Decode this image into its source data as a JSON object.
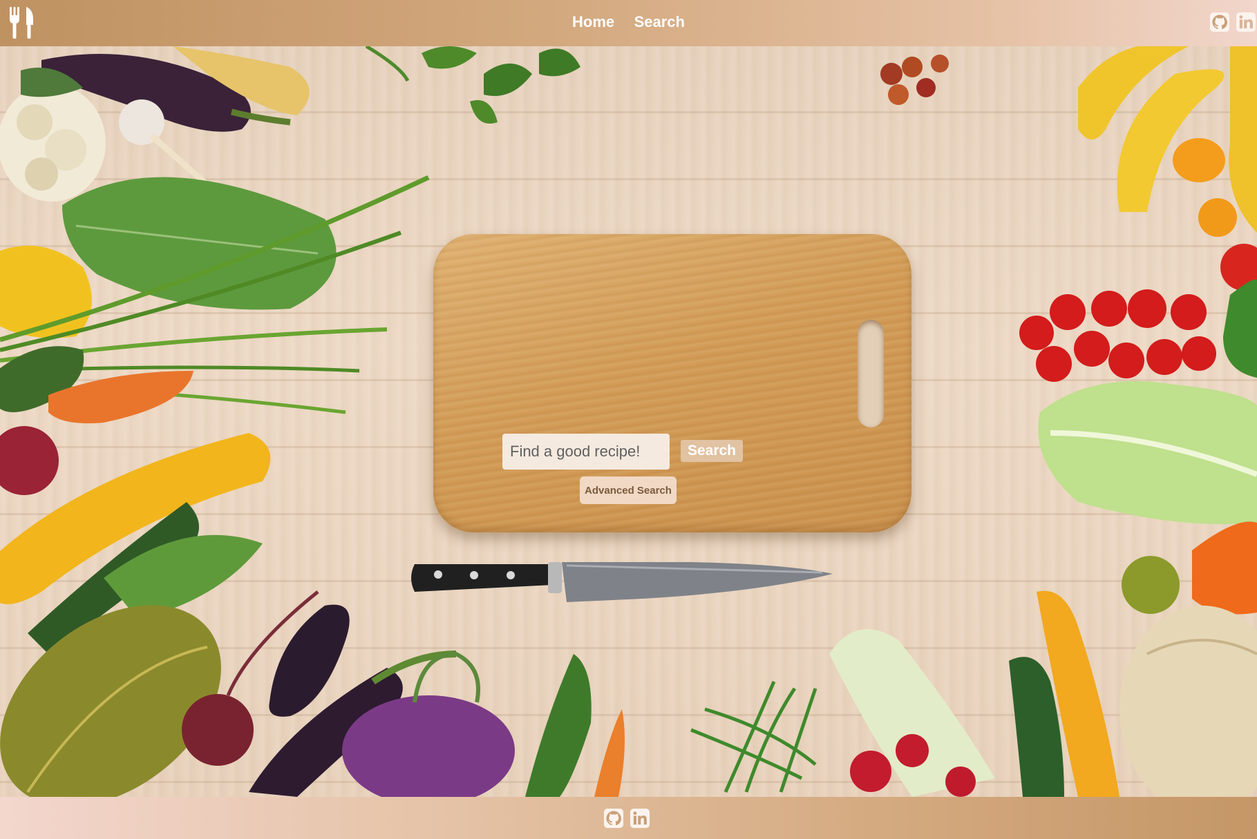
{
  "header": {
    "nav": [
      {
        "label": "Home"
      },
      {
        "label": "Search"
      }
    ],
    "social": [
      {
        "icon": "github-icon"
      },
      {
        "icon": "linkedin-icon"
      }
    ]
  },
  "search": {
    "placeholder": "Find a good recipe!",
    "value": "",
    "button_label": "Search",
    "advanced_label": "Advanced Search"
  },
  "footer": {
    "social": [
      {
        "icon": "github-icon"
      },
      {
        "icon": "linkedin-icon"
      }
    ]
  },
  "colors": {
    "header_start": "#bf9261",
    "header_end": "#f2d6cb",
    "board": "#d19a55",
    "button_text": "#ffffff"
  }
}
